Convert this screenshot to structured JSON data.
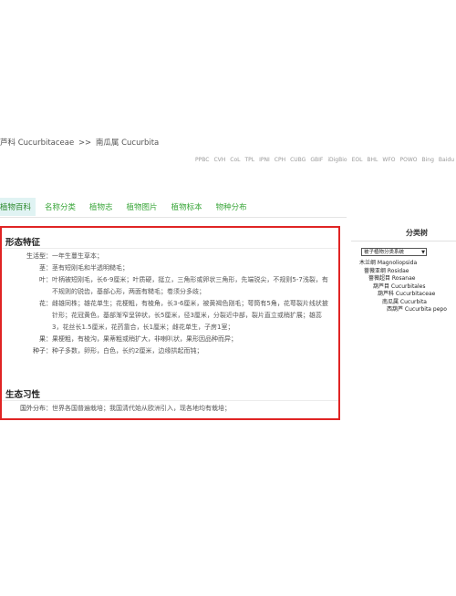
{
  "breadcrumb": {
    "family": "芦科 Cucurbitaceae",
    "sep": ">>",
    "genus": "南瓜属 Cucurbita"
  },
  "external_links": [
    "PPBC",
    "CVH",
    "CoL",
    "TPL",
    "IPNI",
    "CPH",
    "CUBG",
    "GBIF",
    "iDigBio",
    "EOL",
    "BHL",
    "WFO",
    "POWO",
    "Bing",
    "Baidu"
  ],
  "tabs": [
    "植物百科",
    "名称分类",
    "植物志",
    "植物图片",
    "植物标本",
    "物种分布"
  ],
  "morphology": {
    "title": "形态特征",
    "rows": [
      {
        "label": "生活型：",
        "value": "一年生蔓生草本；"
      },
      {
        "label": "茎：",
        "value": "茎有短刚毛和半透明糙毛；"
      },
      {
        "label": "叶：",
        "value": "叶柄被短刚毛，长6-9厘米；叶质硬，挺立，三角形或卵状三角形，先端锐尖，不规则5-7浅裂，有不规则的锐齿，基部心形，两面有糙毛；卷须分多歧；"
      },
      {
        "label": "花：",
        "value": "雌雄同株；雄花单生；花梗粗，有棱角，长3-6厘米，被黄褐色刚毛；萼筒有5角，花萼裂片线状披针形；花冠黄色，基部渐窄呈钟状，长5厘米，径3厘米，分裂近中部，裂片直立或稍扩展；雄蕊3，花丝长1.5厘米，花药靠合，长1厘米；雌花单生，子房1室；"
      },
      {
        "label": "果：",
        "value": "果梗粗，有棱沟，果蒂粗或稍扩大，非喇叭状，果形因品种而异；"
      },
      {
        "label": "种子：",
        "value": "种子多数，卵形，白色，长约2厘米，边缘拱起而钝；"
      }
    ]
  },
  "ecology": {
    "title": "生态习性",
    "rows": [
      {
        "label": "国外分布：",
        "value": "世界各国普遍栽培；我国清代始从欧洲引入，现各地均有栽培；"
      }
    ]
  },
  "sidebar": {
    "title": "分类树",
    "select_value": "被子植物分类系统",
    "tree": [
      {
        "text": "木兰纲 Magnoliopsida",
        "level": 0
      },
      {
        "text": "蔷薇亚纲 Rosidae",
        "level": 1
      },
      {
        "text": "蔷薇超目 Rosanae",
        "level": 2
      },
      {
        "text": "葫芦目 Cucurbitales",
        "level": 3
      },
      {
        "text": "葫芦科 Cucurbitaceae",
        "level": 4
      },
      {
        "text": "南瓜属 Cucurbita",
        "level": 5
      },
      {
        "text": "西葫芦 Cucurbita pepo",
        "level": 6
      }
    ]
  },
  "colors": {
    "accent": "#3aa63a",
    "highlight_border": "#e02424",
    "active_tab_bg": "#e0f3f3"
  }
}
